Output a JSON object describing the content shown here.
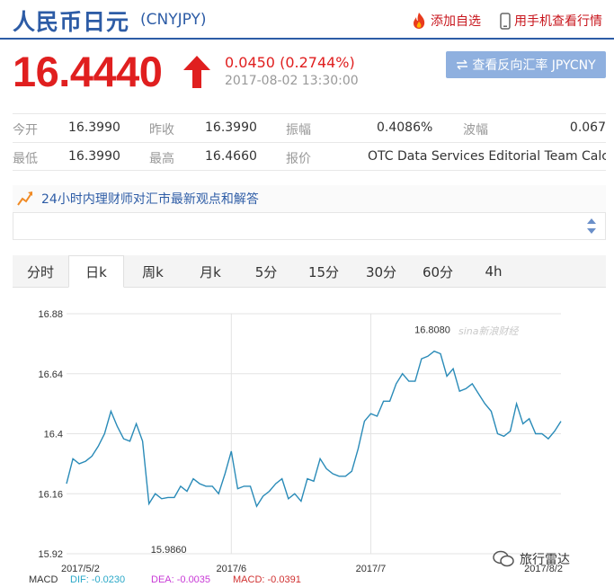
{
  "header": {
    "title": "人民币日元",
    "code": "(CNYJPY)",
    "add_favorite": "添加自选",
    "mobile_view": "用手机查看行情"
  },
  "quote": {
    "price": "16.4440",
    "change": "0.0450 (0.2744%)",
    "time": "2017-08-02 13:30:00",
    "reverse_button": "查看反向汇率 JPYCNY"
  },
  "stats": [
    [
      {
        "label": "今开",
        "value": "16.3990"
      },
      {
        "label": "昨收",
        "value": "16.3990"
      },
      {
        "label": "振幅",
        "value": "0.4086%"
      },
      {
        "label": "波幅",
        "value": "0.067"
      }
    ],
    [
      {
        "label": "最低",
        "value": "16.3990"
      },
      {
        "label": "最高",
        "value": "16.4660"
      },
      {
        "label": "报价",
        "value": "OTC Data Services Editorial Team Calc..."
      }
    ]
  ],
  "advice": {
    "title": "24小时内理财师对汇市最新观点和解答"
  },
  "tabs": [
    "分时",
    "日k",
    "周k",
    "月k",
    "5分",
    "15分",
    "30分",
    "60分",
    "4h"
  ],
  "active_tab": "日k",
  "colors": {
    "brand_blue": "#2d5ca6",
    "up_red": "#e01f1f",
    "line": "#2a8bb8",
    "button": "#8fb0df"
  },
  "chart_data": {
    "type": "line",
    "y_ticks": [
      "16.88",
      "16.64",
      "16.4",
      "16.16",
      "15.92"
    ],
    "ylim": [
      15.92,
      16.88
    ],
    "x_labels": [
      "2017/5/2",
      "2017/6",
      "2017/7",
      "2017/8/2"
    ],
    "max_label": "16.8080",
    "min_label": "15.9860",
    "watermark": "sina新浪财经",
    "values": [
      16.2,
      16.3,
      16.28,
      16.29,
      16.31,
      16.35,
      16.4,
      16.49,
      16.43,
      16.38,
      16.37,
      16.44,
      16.37,
      16.12,
      16.16,
      16.14,
      16.145,
      16.145,
      16.19,
      16.17,
      16.22,
      16.2,
      16.19,
      16.19,
      16.16,
      16.24,
      16.33,
      16.18,
      16.19,
      16.19,
      16.11,
      16.15,
      16.17,
      16.2,
      16.22,
      16.14,
      16.16,
      16.13,
      16.22,
      16.21,
      16.3,
      16.26,
      16.24,
      16.23,
      16.23,
      16.25,
      16.34,
      16.45,
      16.48,
      16.47,
      16.53,
      16.53,
      16.6,
      16.64,
      16.61,
      16.61,
      16.7,
      16.71,
      16.73,
      16.72,
      16.63,
      16.66,
      16.57,
      16.58,
      16.6,
      16.56,
      16.52,
      16.49,
      16.4,
      16.39,
      16.41,
      16.52,
      16.44,
      16.46,
      16.4,
      16.4,
      16.38,
      16.41,
      16.45
    ],
    "max_index": 58,
    "min_index": 13,
    "x_label_indices": [
      0,
      26,
      48,
      76
    ]
  },
  "macd": {
    "label": "MACD",
    "dif": "DIF: -0.0230",
    "dea": "DEA: -0.0035",
    "macd": "MACD: -0.0391"
  },
  "footer": {
    "brand": "旅行雷达"
  }
}
